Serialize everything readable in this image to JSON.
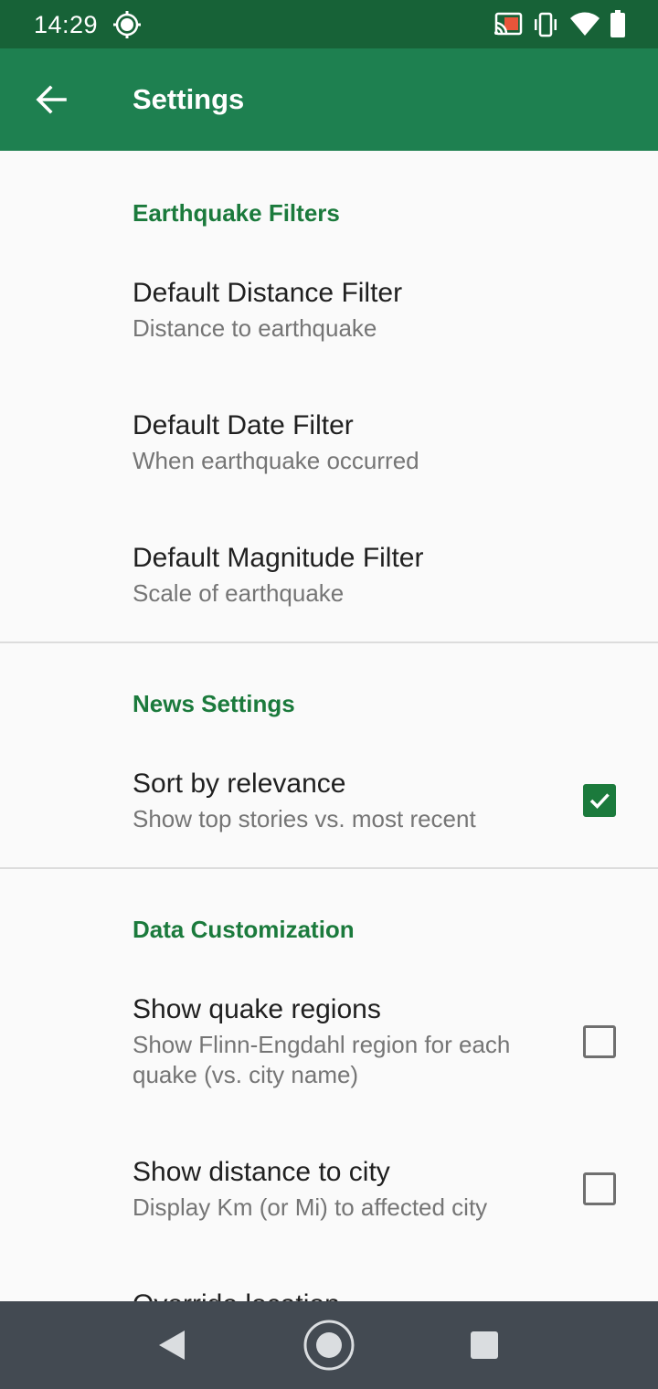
{
  "status_bar": {
    "time": "14:29",
    "icons": [
      "sync-icon",
      "cast-icon",
      "vibrate-icon",
      "wifi-icon",
      "battery-icon"
    ]
  },
  "app_bar": {
    "title": "Settings",
    "back_icon": "arrow-back-icon"
  },
  "sections": [
    {
      "header": "Earthquake Filters",
      "items": [
        {
          "title": "Default Distance Filter",
          "summary": "Distance to earthquake"
        },
        {
          "title": "Default Date Filter",
          "summary": "When earthquake occurred"
        },
        {
          "title": "Default Magnitude Filter",
          "summary": "Scale of earthquake"
        }
      ]
    },
    {
      "header": "News Settings",
      "items": [
        {
          "title": "Sort by relevance",
          "summary": "Show top stories vs. most recent",
          "checked": true
        }
      ]
    },
    {
      "header": "Data Customization",
      "items": [
        {
          "title": "Show quake regions",
          "summary": "Show Flinn-Engdahl region for each quake (vs. city name)",
          "checked": false
        },
        {
          "title": "Show distance to city",
          "summary": "Display Km (or Mi) to affected city",
          "checked": false
        },
        {
          "title": "Override location",
          "summary": ""
        }
      ]
    }
  ],
  "nav_bar": {
    "icons": [
      "nav-back-icon",
      "nav-home-icon",
      "nav-recents-icon"
    ]
  },
  "colors": {
    "status_bar": "#176237",
    "app_bar": "#1e8050",
    "accent": "#1b7a3c",
    "nav_bar": "#434a52"
  }
}
